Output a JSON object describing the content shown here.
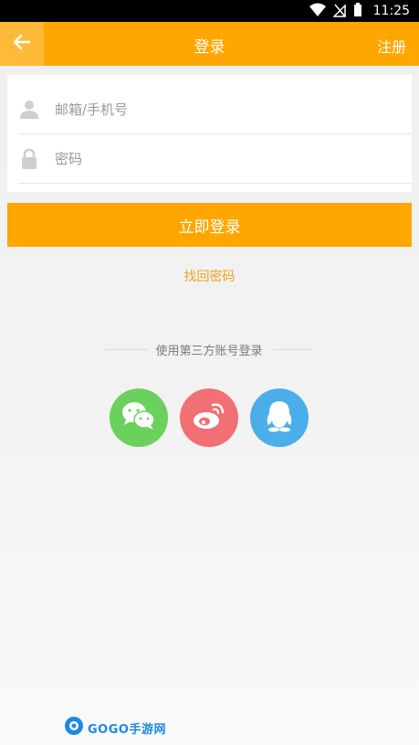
{
  "status_bar": {
    "time": "11:25",
    "icons": [
      "wifi-icon",
      "signal-icon",
      "battery-icon"
    ]
  },
  "app_bar": {
    "title": "登录",
    "register_label": "注册",
    "back_icon": "arrow-left-icon"
  },
  "form": {
    "account_placeholder": "邮箱/手机号",
    "account_value": "",
    "password_placeholder": "密码",
    "password_value": "",
    "account_icon": "user-icon",
    "password_icon": "lock-icon"
  },
  "login_button_label": "立即登录",
  "forgot_password_label": "找回密码",
  "third_party": {
    "label": "使用第三方账号登录",
    "providers": [
      "wechat-icon",
      "weibo-icon",
      "qq-icon"
    ]
  },
  "watermark": {
    "text": "GOGO手游网"
  },
  "colors": {
    "accent": "#ffa600",
    "wechat": "#6bd15d",
    "weibo": "#f26f73",
    "qq": "#4aaeea"
  }
}
